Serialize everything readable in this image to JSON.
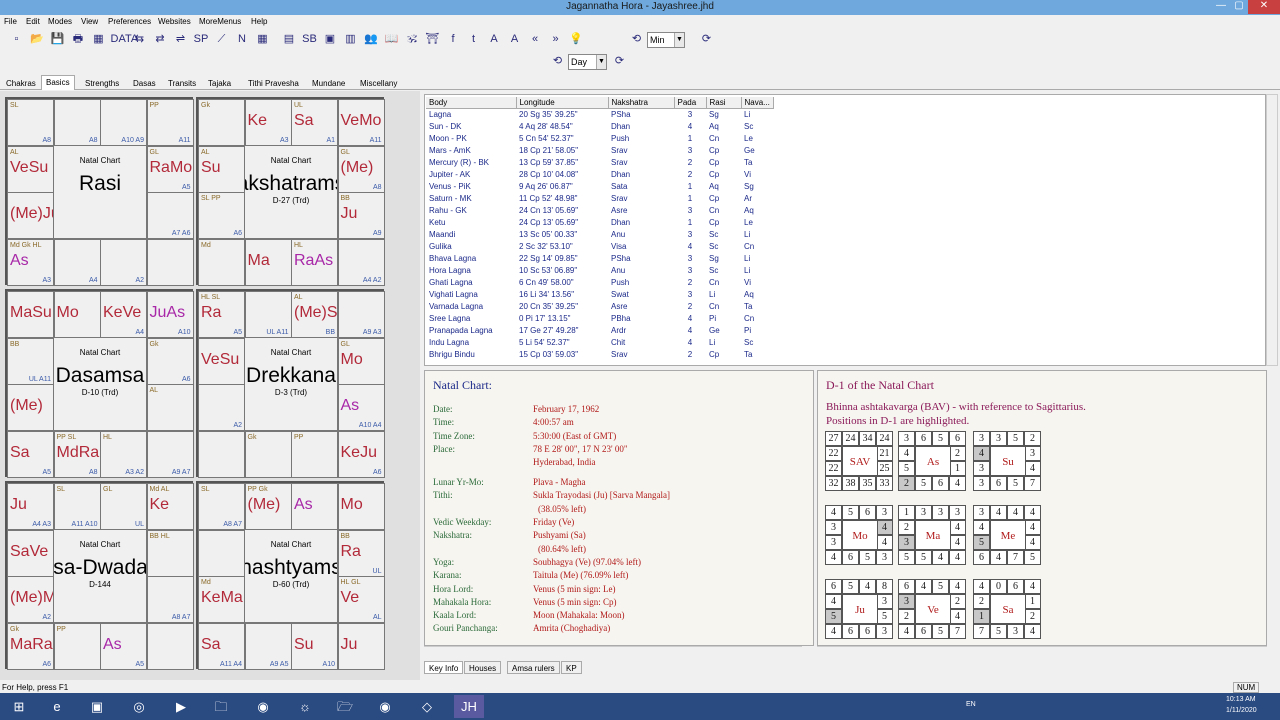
{
  "window": {
    "title": "Jagannatha Hora - Jayashree.jhd",
    "min": "—",
    "max": "▢",
    "close": "✕"
  },
  "menu": [
    "File",
    "Edit",
    "Modes",
    "View",
    "Preferences",
    "Websites",
    "MoreMenus",
    "Help"
  ],
  "toolbar": {
    "icons": [
      "new-file-icon",
      "open-folder-icon",
      "save-icon",
      "print-icon",
      "chart-icon",
      "data-icon",
      "transit-icon",
      "back-icon",
      "forward-icon",
      "sp-kh-icon",
      "walk-icon",
      "n-icon",
      "grid-icon",
      "table-icon",
      "sb-icon",
      "frame-icon",
      "calendar-icon",
      "people-icon",
      "book-icon",
      "deity-icon",
      "temple-icon",
      "facebook-icon",
      "twitter-icon",
      "font-large-icon",
      "font-small-icon",
      "rewind-icon",
      "fast-forward-icon",
      "light-icon",
      "clock-back-icon",
      "clock-forward-icon"
    ],
    "labels": [
      "▫",
      "📂",
      "💾",
      "🖶",
      "▦",
      "DATA",
      "⇆",
      "⇄",
      "⇌",
      "SP",
      "⟋",
      "N",
      "▦",
      "▤",
      "SB",
      "▣",
      "▥",
      "👥",
      "📖",
      "🕉",
      "⛩",
      "f",
      "t",
      "A",
      "A",
      "«",
      "»",
      "💡",
      "⟲",
      "⟳"
    ],
    "step_unit": "Min",
    "step_unit2": "Day"
  },
  "tabs": [
    "Chakras",
    "Basics",
    "Strengths",
    "Dasas",
    "Transits",
    "Tajaka",
    "Tithi Pravesha",
    "Mundane",
    "Miscellany"
  ],
  "active_tab": "Basics",
  "charts": [
    {
      "title": "Natal Chart",
      "name": "Rasi",
      "sub": "",
      "cells": [
        {
          "r": 0,
          "c": 0,
          "sm": "SL",
          "bl": "A8",
          "big": ""
        },
        {
          "r": 0,
          "c": 1,
          "sm": "",
          "bl": "A8",
          "big": ""
        },
        {
          "r": 0,
          "c": 2,
          "sm": "",
          "bl": "A10 A9",
          "big": ""
        },
        {
          "r": 0,
          "c": 3,
          "sm": "PP",
          "bl": "A11",
          "big": ""
        },
        {
          "r": 1,
          "c": 0,
          "sm": "AL",
          "bl": "",
          "big": "VeSu"
        },
        {
          "r": 1,
          "c": 3,
          "sm": "GL",
          "bl": "A5",
          "big": "RaMo"
        },
        {
          "r": 2,
          "c": 0,
          "sm": "",
          "bl": "",
          "big": "(Me)Ju"
        },
        {
          "r": 2,
          "c": 3,
          "sm": "",
          "bl": "A7 A6",
          "big": ""
        },
        {
          "r": 3,
          "c": 0,
          "sm": "Md Gk HL",
          "bl": "A3",
          "big": "As"
        },
        {
          "r": 3,
          "c": 1,
          "sm": "",
          "bl": "A4",
          "big": ""
        },
        {
          "r": 3,
          "c": 2,
          "sm": "",
          "bl": "A2",
          "big": ""
        },
        {
          "r": 3,
          "c": 3,
          "sm": "",
          "bl": "",
          "big": ""
        }
      ]
    },
    {
      "title": "Natal Chart",
      "name": "akshatrams",
      "sub": "D-27 (Trd)",
      "cells": [
        {
          "r": 0,
          "c": 0,
          "sm": "Gk",
          "bl": "",
          "big": ""
        },
        {
          "r": 0,
          "c": 1,
          "sm": "",
          "bl": "A3",
          "big": "Ke"
        },
        {
          "r": 0,
          "c": 2,
          "sm": "UL",
          "bl": "A1",
          "big": "Sa"
        },
        {
          "r": 0,
          "c": 3,
          "sm": "",
          "bl": "A11",
          "big": "VeMo"
        },
        {
          "r": 1,
          "c": 0,
          "sm": "AL",
          "bl": "",
          "big": "Su"
        },
        {
          "r": 1,
          "c": 3,
          "sm": "GL",
          "bl": "A8",
          "big": "(Me)"
        },
        {
          "r": 2,
          "c": 0,
          "sm": "SL PP",
          "bl": "A6",
          "big": ""
        },
        {
          "r": 2,
          "c": 3,
          "sm": "BB",
          "bl": "A9",
          "big": "Ju"
        },
        {
          "r": 3,
          "c": 0,
          "sm": "Md",
          "bl": "",
          "big": ""
        },
        {
          "r": 3,
          "c": 1,
          "sm": "",
          "bl": "",
          "big": "Ma"
        },
        {
          "r": 3,
          "c": 2,
          "sm": "HL",
          "bl": "",
          "big": "RaAs"
        },
        {
          "r": 3,
          "c": 3,
          "sm": "",
          "bl": "A4 A2",
          "big": ""
        }
      ]
    },
    {
      "title": "Natal Chart",
      "name": "Dasamsa",
      "sub": "D-10 (Trd)",
      "cells": [
        {
          "r": 0,
          "c": 0,
          "sm": "",
          "bl": "",
          "big": "MaSu"
        },
        {
          "r": 0,
          "c": 1,
          "sm": "",
          "bl": "",
          "big": "Mo"
        },
        {
          "r": 0,
          "c": 2,
          "sm": "",
          "bl": "A4",
          "big": "KeVe"
        },
        {
          "r": 0,
          "c": 3,
          "sm": "",
          "bl": "A10",
          "big": "JuAs"
        },
        {
          "r": 1,
          "c": 0,
          "sm": "BB",
          "bl": "UL A11",
          "big": ""
        },
        {
          "r": 1,
          "c": 3,
          "sm": "Gk",
          "bl": "A6",
          "big": ""
        },
        {
          "r": 2,
          "c": 0,
          "sm": "",
          "bl": "",
          "big": "(Me)"
        },
        {
          "r": 2,
          "c": 3,
          "sm": "AL",
          "bl": "",
          "big": ""
        },
        {
          "r": 3,
          "c": 0,
          "sm": "",
          "bl": "A5",
          "big": "Sa"
        },
        {
          "r": 3,
          "c": 1,
          "sm": "PP SL",
          "bl": "A8",
          "big": "MdRa"
        },
        {
          "r": 3,
          "c": 2,
          "sm": "HL",
          "bl": "A3 A2",
          "big": ""
        },
        {
          "r": 3,
          "c": 3,
          "sm": "",
          "bl": "A9 A7",
          "big": ""
        }
      ]
    },
    {
      "title": "Natal Chart",
      "name": "Drekkana",
      "sub": "D-3 (Trd)",
      "cells": [
        {
          "r": 0,
          "c": 0,
          "sm": "HL SL",
          "bl": "A5",
          "big": "Ra"
        },
        {
          "r": 0,
          "c": 1,
          "sm": "",
          "bl": "UL A11",
          "big": ""
        },
        {
          "r": 0,
          "c": 2,
          "sm": "AL",
          "bl": "BB",
          "big": "(Me)Sa"
        },
        {
          "r": 0,
          "c": 3,
          "sm": "",
          "bl": "A9 A3",
          "big": ""
        },
        {
          "r": 1,
          "c": 0,
          "sm": "",
          "bl": "",
          "big": "VeSu"
        },
        {
          "r": 1,
          "c": 3,
          "sm": "GL",
          "bl": "",
          "big": "Mo"
        },
        {
          "r": 2,
          "c": 0,
          "sm": "",
          "bl": "A2",
          "big": ""
        },
        {
          "r": 2,
          "c": 3,
          "sm": "",
          "bl": "A10 A4",
          "big": "As"
        },
        {
          "r": 3,
          "c": 0,
          "sm": "",
          "bl": "",
          "big": ""
        },
        {
          "r": 3,
          "c": 1,
          "sm": "Gk",
          "bl": "",
          "big": ""
        },
        {
          "r": 3,
          "c": 2,
          "sm": "PP",
          "bl": "",
          "big": ""
        },
        {
          "r": 3,
          "c": 3,
          "sm": "",
          "bl": "A6",
          "big": "KeJu"
        }
      ]
    },
    {
      "title": "Natal Chart",
      "name": "asa-Dwadas",
      "sub": "D-144",
      "cells": [
        {
          "r": 0,
          "c": 0,
          "sm": "",
          "bl": "A4 A3",
          "big": "Ju"
        },
        {
          "r": 0,
          "c": 1,
          "sm": "SL",
          "bl": "A11 A10",
          "big": ""
        },
        {
          "r": 0,
          "c": 2,
          "sm": "GL",
          "bl": "UL",
          "big": ""
        },
        {
          "r": 0,
          "c": 3,
          "sm": "Md AL",
          "bl": "",
          "big": "Ke"
        },
        {
          "r": 1,
          "c": 0,
          "sm": "",
          "bl": "",
          "big": "SaVe"
        },
        {
          "r": 1,
          "c": 3,
          "sm": "BB HL",
          "bl": "",
          "big": ""
        },
        {
          "r": 2,
          "c": 0,
          "sm": "",
          "bl": "A2",
          "big": "(Me)Mo"
        },
        {
          "r": 2,
          "c": 3,
          "sm": "",
          "bl": "A8 A7",
          "big": ""
        },
        {
          "r": 3,
          "c": 0,
          "sm": "Gk",
          "bl": "A6",
          "big": "MaRa"
        },
        {
          "r": 3,
          "c": 1,
          "sm": "PP",
          "bl": "",
          "big": ""
        },
        {
          "r": 3,
          "c": 2,
          "sm": "",
          "bl": "A5",
          "big": "As"
        },
        {
          "r": 3,
          "c": 3,
          "sm": "",
          "bl": "",
          "big": ""
        }
      ]
    },
    {
      "title": "Natal Chart",
      "name": "hashtyams",
      "sub": "D-60 (Trd)",
      "cells": [
        {
          "r": 0,
          "c": 0,
          "sm": "SL",
          "bl": "A8 A7",
          "big": ""
        },
        {
          "r": 0,
          "c": 1,
          "sm": "PP Gk",
          "bl": "",
          "big": "(Me)"
        },
        {
          "r": 0,
          "c": 2,
          "sm": "",
          "bl": "",
          "big": "As"
        },
        {
          "r": 0,
          "c": 3,
          "sm": "",
          "bl": "",
          "big": "Mo"
        },
        {
          "r": 1,
          "c": 0,
          "sm": "",
          "bl": "",
          "big": ""
        },
        {
          "r": 1,
          "c": 3,
          "sm": "BB",
          "bl": "UL",
          "big": "Ra"
        },
        {
          "r": 2,
          "c": 0,
          "sm": "Md",
          "bl": "",
          "big": "KeMa"
        },
        {
          "r": 2,
          "c": 3,
          "sm": "HL GL",
          "bl": "AL",
          "big": "Ve"
        },
        {
          "r": 3,
          "c": 0,
          "sm": "",
          "bl": "A11 A4",
          "big": "Sa"
        },
        {
          "r": 3,
          "c": 1,
          "sm": "",
          "bl": "A9 A5",
          "big": ""
        },
        {
          "r": 3,
          "c": 2,
          "sm": "",
          "bl": "A10",
          "big": "Su"
        },
        {
          "r": 3,
          "c": 3,
          "sm": "",
          "bl": "",
          "big": "Ju"
        }
      ]
    }
  ],
  "planet_table": {
    "headers": [
      "Body",
      "Longitude",
      "Nakshatra",
      "Pada",
      "Rasi",
      "Nava..."
    ],
    "rows": [
      [
        "Lagna",
        "20 Sg 35' 39.25\"",
        "PSha",
        "3",
        "Sg",
        "Li"
      ],
      [
        "Sun - DK",
        "4 Aq 28' 48.54\"",
        "Dhan",
        "4",
        "Aq",
        "Sc"
      ],
      [
        "Moon - PK",
        "5 Cn 54' 52.37\"",
        "Push",
        "1",
        "Cn",
        "Le"
      ],
      [
        "Mars - AmK",
        "18 Cp 21' 58.05\"",
        "Srav",
        "3",
        "Cp",
        "Ge"
      ],
      [
        "Mercury (R) - BK",
        "13 Cp 59' 37.85\"",
        "Srav",
        "2",
        "Cp",
        "Ta"
      ],
      [
        "Jupiter - AK",
        "28 Cp 10' 04.08\"",
        "Dhan",
        "2",
        "Cp",
        "Vi"
      ],
      [
        "Venus - PiK",
        "9 Aq 26' 06.87\"",
        "Sata",
        "1",
        "Aq",
        "Sg"
      ],
      [
        "Saturn - MK",
        "11 Cp 52' 48.98\"",
        "Srav",
        "1",
        "Cp",
        "Ar"
      ],
      [
        "Rahu - GK",
        "24 Cn 13' 05.69\"",
        "Asre",
        "3",
        "Cn",
        "Aq"
      ],
      [
        "Ketu",
        "24 Cp 13' 05.69\"",
        "Dhan",
        "1",
        "Cp",
        "Le"
      ],
      [
        "Maandi",
        "13 Sc 05' 00.33\"",
        "Anu",
        "3",
        "Sc",
        "Li"
      ],
      [
        "Gulika",
        "2 Sc 32' 53.10\"",
        "Visa",
        "4",
        "Sc",
        "Cn"
      ],
      [
        "Bhava Lagna",
        "22 Sg 14' 09.85\"",
        "PSha",
        "3",
        "Sg",
        "Li"
      ],
      [
        "Hora Lagna",
        "10 Sc 53' 06.89\"",
        "Anu",
        "3",
        "Sc",
        "Li"
      ],
      [
        "Ghati Lagna",
        "6 Cn 49' 58.00\"",
        "Push",
        "2",
        "Cn",
        "Vi"
      ],
      [
        "Vighati Lagna",
        "16 Li 34' 13.56\"",
        "Swat",
        "3",
        "Li",
        "Aq"
      ],
      [
        "Varnada Lagna",
        "20 Cn 35' 39.25\"",
        "Asre",
        "2",
        "Cn",
        "Ta"
      ],
      [
        "Sree Lagna",
        "0 Pi 17' 13.15\"",
        "PBha",
        "4",
        "Pi",
        "Cn"
      ],
      [
        "Pranapada Lagna",
        "17 Ge 27' 49.28\"",
        "Ardr",
        "4",
        "Ge",
        "Pi"
      ],
      [
        "Indu Lagna",
        "5 Li 54' 52.37\"",
        "Chit",
        "4",
        "Li",
        "Sc"
      ],
      [
        "Bhrigu Bindu",
        "15 Cp 03' 59.03\"",
        "Srav",
        "2",
        "Cp",
        "Ta"
      ]
    ]
  },
  "info": {
    "heading": "Natal Chart:",
    "rows": [
      [
        "Date:",
        "February 17, 1962"
      ],
      [
        "Time:",
        "4:00:57 am"
      ],
      [
        "Time Zone:",
        "5:30:00 (East of GMT)"
      ],
      [
        "Place:",
        "78 E 28' 00\", 17 N 23' 00\""
      ],
      [
        "",
        "Hyderabad, India"
      ],
      [
        "Lunar Yr-Mo:",
        "Plava - Magha"
      ],
      [
        "Tithi:",
        "Sukla Trayodasi (Ju) [Sarva Mangala]"
      ],
      [
        "",
        "(38.05% left)"
      ],
      [
        "Vedic Weekday:",
        "Friday (Ve)"
      ],
      [
        "Nakshatra:",
        "Pushyami (Sa)"
      ],
      [
        "",
        "(80.64% left)"
      ],
      [
        "Yoga:",
        "Soubhagya (Ve) (97.04% left)"
      ],
      [
        "Karana:",
        "Taitula (Me) (76.09% left)"
      ],
      [
        "Hora Lord:",
        "Venus (5 min sign: Le)"
      ],
      [
        "Mahakala Hora:",
        "Venus (5 min sign: Cp)"
      ],
      [
        "Kaala Lord:",
        "Moon (Mahakala: Moon)"
      ],
      [
        "Gouri Panchanga:",
        "Amrita (Choghadiya)"
      ]
    ]
  },
  "bav": {
    "heading": "D-1 of the Natal Chart",
    "desc1": "Bhinna ashtakavarga (BAV) - with reference to Sagittarius.",
    "desc2": "Positions in D-1 are highlighted.",
    "grids": [
      {
        "name": "SAV",
        "top": [
          "27",
          "24",
          "34",
          "24"
        ],
        "left": [
          "22",
          "22"
        ],
        "right": [
          "21",
          "25"
        ],
        "bottom": [
          "32",
          "38",
          "35",
          "33"
        ],
        "hl": []
      },
      {
        "name": "As",
        "top": [
          "3",
          "6",
          "5",
          "6"
        ],
        "left": [
          "4",
          "5"
        ],
        "right": [
          "2",
          "1"
        ],
        "bottom": [
          "2",
          "5",
          "6",
          "4"
        ],
        "hl": [
          "b0"
        ]
      },
      {
        "name": "Su",
        "top": [
          "3",
          "3",
          "5",
          "2"
        ],
        "left": [
          "4",
          "3"
        ],
        "right": [
          "3",
          "4"
        ],
        "bottom": [
          "3",
          "6",
          "5",
          "7"
        ],
        "hl": [
          "l0"
        ]
      },
      {
        "name": "Mo",
        "top": [
          "4",
          "5",
          "6",
          "3"
        ],
        "left": [
          "3",
          "3"
        ],
        "right": [
          "4",
          "4"
        ],
        "bottom": [
          "4",
          "6",
          "5",
          "3"
        ],
        "hl": [
          "r0"
        ]
      },
      {
        "name": "Ma",
        "top": [
          "1",
          "3",
          "3",
          "3"
        ],
        "left": [
          "2",
          "3"
        ],
        "right": [
          "4",
          "4"
        ],
        "bottom": [
          "5",
          "5",
          "4",
          "4"
        ],
        "hl": [
          "l1"
        ]
      },
      {
        "name": "Me",
        "top": [
          "3",
          "4",
          "4",
          "4"
        ],
        "left": [
          "4",
          "5"
        ],
        "right": [
          "4",
          "4"
        ],
        "bottom": [
          "6",
          "4",
          "7",
          "5"
        ],
        "hl": [
          "l1"
        ]
      },
      {
        "name": "Ju",
        "top": [
          "6",
          "5",
          "4",
          "8"
        ],
        "left": [
          "4",
          "5"
        ],
        "right": [
          "3",
          "5"
        ],
        "bottom": [
          "4",
          "6",
          "6",
          "3"
        ],
        "hl": [
          "l1"
        ]
      },
      {
        "name": "Ve",
        "top": [
          "6",
          "4",
          "5",
          "4"
        ],
        "left": [
          "3",
          "2"
        ],
        "right": [
          "2",
          "4"
        ],
        "bottom": [
          "4",
          "6",
          "5",
          "7"
        ],
        "hl": [
          "l0"
        ]
      },
      {
        "name": "Sa",
        "top": [
          "4",
          "0",
          "6",
          "4"
        ],
        "left": [
          "2",
          "1"
        ],
        "right": [
          "1",
          "2"
        ],
        "bottom": [
          "7",
          "5",
          "3",
          "4"
        ],
        "hl": [
          "l1"
        ]
      }
    ]
  },
  "bottom_tabs": [
    "Key Info",
    "Houses",
    "Amsa rulers",
    "KP"
  ],
  "status": {
    "help": "For Help, press F1",
    "num": "NUM"
  },
  "taskbar": {
    "lang": "EN",
    "time": "10:13 AM",
    "date": "1/11/2020"
  }
}
